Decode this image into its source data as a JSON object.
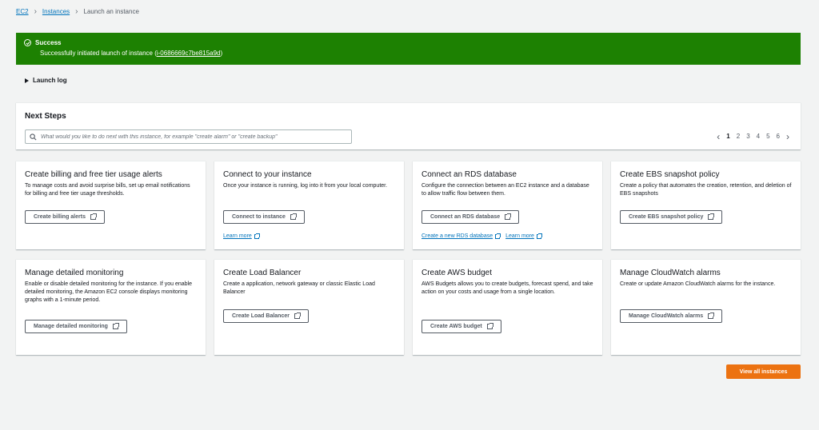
{
  "breadcrumb": {
    "ec2": "EC2",
    "instances": "Instances",
    "current": "Launch an instance"
  },
  "flash": {
    "title": "Success",
    "message": "Successfully initiated launch of instance (",
    "instance_id": "i-0686669c7be815a9d",
    "message_end": ")",
    "color": "#1d8102"
  },
  "launch_log": {
    "label": "Launch log"
  },
  "next_steps": {
    "title": "Next Steps",
    "search_placeholder": "What would you like to do next with this instance, for example \"create alarm\" or \"create backup\"",
    "pages": [
      "1",
      "2",
      "3",
      "4",
      "5",
      "6"
    ],
    "current_page": "1"
  },
  "cards": {
    "billing": {
      "title": "Create billing and free tier usage alerts",
      "description": "To manage costs and avoid surprise bills, set up email notifications for billing and free tier usage thresholds.",
      "button": "Create billing alerts"
    },
    "connect": {
      "title": "Connect to your instance",
      "description": "Once your instance is running, log into it from your local computer.",
      "button": "Connect to instance",
      "link1": "Learn more"
    },
    "rds": {
      "title": "Connect an RDS database",
      "description": "Configure the connection between an EC2 instance and a database to allow traffic flow between them.",
      "button": "Connect an RDS database",
      "link1": "Create a new RDS database",
      "link2": "Learn more"
    },
    "ebs": {
      "title": "Create EBS snapshot policy",
      "description": "Create a policy that automates the creation, retention, and deletion of EBS snapshots",
      "button": "Create EBS snapshot policy"
    },
    "monitoring": {
      "title": "Manage detailed monitoring",
      "description": "Enable or disable detailed monitoring for the instance. If you enable detailed monitoring, the Amazon EC2 console displays monitoring graphs with a 1-minute period.",
      "button": "Manage detailed monitoring"
    },
    "lb": {
      "title": "Create Load Balancer",
      "description": "Create a application, network gateway or classic Elastic Load Balancer",
      "button": "Create Load Balancer"
    },
    "budget": {
      "title": "Create AWS budget",
      "description": "AWS Budgets allows you to create budgets, forecast spend, and take action on your costs and usage from a single location.",
      "button": "Create AWS budget"
    },
    "cloudwatch": {
      "title": "Manage CloudWatch alarms",
      "description": "Create or update Amazon CloudWatch alarms for the instance.",
      "button": "Manage CloudWatch alarms"
    }
  },
  "view_all": {
    "label": "View all instances",
    "color": "#ec7211"
  }
}
